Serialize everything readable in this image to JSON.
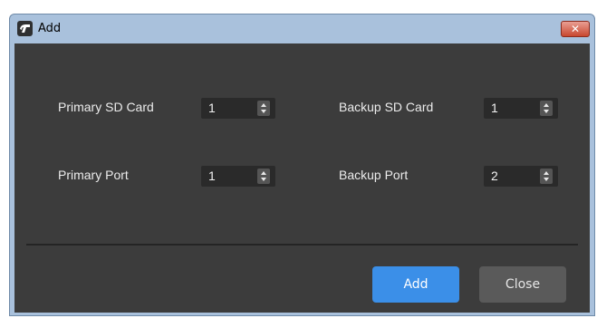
{
  "window": {
    "title": "Add",
    "close_glyph": "✕"
  },
  "form": {
    "primary_sd_card": {
      "label": "Primary SD Card",
      "value": "1"
    },
    "backup_sd_card": {
      "label": "Backup SD Card",
      "value": "1"
    },
    "primary_port": {
      "label": "Primary Port",
      "value": "1"
    },
    "backup_port": {
      "label": "Backup Port",
      "value": "2"
    }
  },
  "buttons": {
    "add_label": "Add",
    "close_label": "Close"
  },
  "colors": {
    "accent": "#3b8fe8",
    "dialog_background": "#3c3c3c",
    "titlebar_close": "#c8472f"
  },
  "icons": {
    "app": "app-logo-icon",
    "spin_arrows": "up-down-arrows-icon"
  }
}
